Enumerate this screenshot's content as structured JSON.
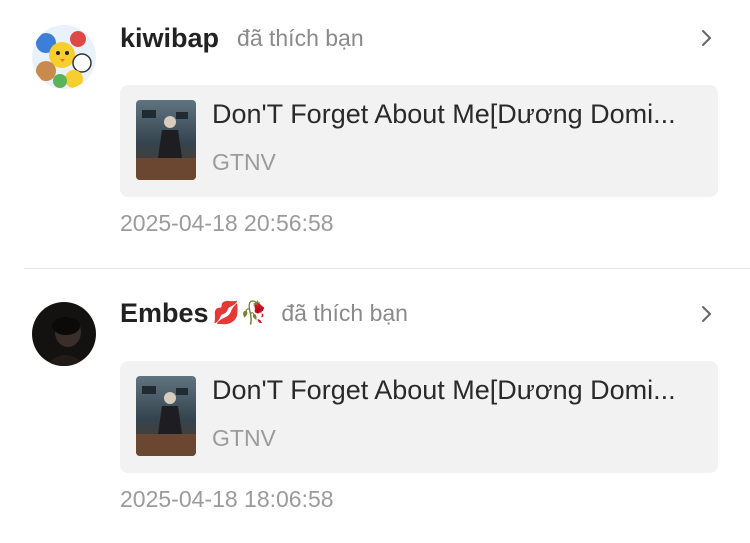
{
  "notifications": [
    {
      "username": "kiwibap",
      "emoji": "",
      "action": "đã thích bạn",
      "song": {
        "title": "Don'T Forget About Me[Dương Domi...",
        "artist": "GTNV"
      },
      "timestamp": "2025-04-18 20:56:58"
    },
    {
      "username": "Embes",
      "emoji": "💋🥀",
      "action": "đã thích bạn",
      "song": {
        "title": "Don'T Forget About Me[Dương Domi...",
        "artist": "GTNV"
      },
      "timestamp": "2025-04-18 18:06:58"
    }
  ],
  "icons": {
    "chevron": "chevron-right-icon"
  },
  "colors": {
    "card_bg": "#f2f2f2",
    "muted_text": "#9b9b9b",
    "username_text": "#222222"
  }
}
